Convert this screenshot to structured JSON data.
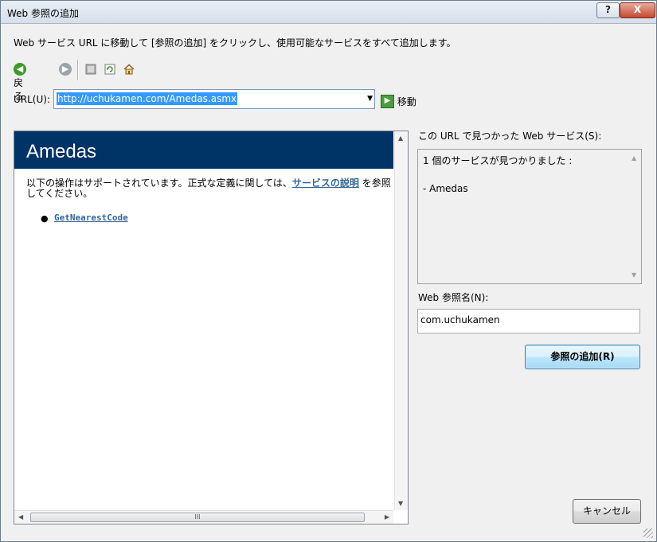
{
  "window": {
    "title": "Web 参照の追加",
    "help_label": "?",
    "close_label": "X"
  },
  "instruction": "Web サービス URL に移動して [参照の追加] をクリックし、使用可能なサービスをすべて追加します。",
  "nav": {
    "back_label": "戻る",
    "back_icon": "back-arrow-icon",
    "forward_icon": "forward-arrow-icon",
    "stop_icon": "stop-icon",
    "refresh_icon": "refresh-icon",
    "home_icon": "home-icon"
  },
  "url": {
    "label": "URL(U):",
    "value": "http://uchukamen.com/Amedas.asmx",
    "go_label": "移動"
  },
  "browser": {
    "header": "Amedas",
    "desc_before": "以下の操作はサポートされています。正式な定義に関しては、",
    "desc_link": "サービスの説明",
    "desc_after": "を参照してください。",
    "operations": [
      "GetNearestCode"
    ],
    "hscroll_grip": "III"
  },
  "found": {
    "label": "この URL で見つかった Web サービス(S):",
    "line1": "1 個のサービスが見つかりました :",
    "line2": "- Amedas"
  },
  "ref": {
    "label": "Web 参照名(N):",
    "value": "com.uchukamen"
  },
  "buttons": {
    "add_label": "参照の追加(R)",
    "cancel_label": "キャンセル"
  },
  "colors": {
    "header_bg": "#003366",
    "link": "#336699",
    "selection": "#3399ff"
  }
}
